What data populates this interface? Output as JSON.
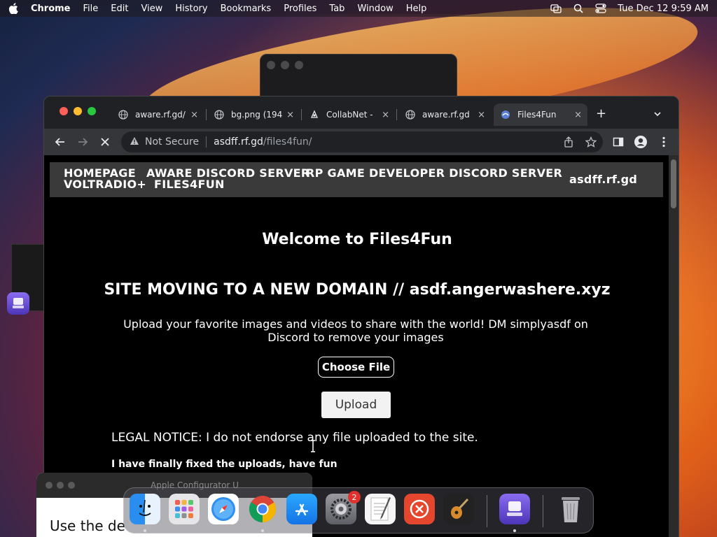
{
  "menubar": {
    "app": "Chrome",
    "items": [
      "File",
      "Edit",
      "View",
      "History",
      "Bookmarks",
      "Profiles",
      "Tab",
      "Window",
      "Help"
    ],
    "clock": "Tue Dec 12  9:59 AM"
  },
  "browser": {
    "tabs": [
      {
        "title": "aware.rf.gd/",
        "icon": "globe-icon"
      },
      {
        "title": "bg.png (194",
        "icon": "globe-icon"
      },
      {
        "title": "CollabNet -",
        "icon": "collabnet-icon"
      },
      {
        "title": "aware.rf.gd",
        "icon": "globe-icon"
      },
      {
        "title": "Files4Fun",
        "icon": "files4fun-icon",
        "active": true
      }
    ],
    "close_glyph": "×",
    "new_tab_glyph": "+",
    "security_label": "Not Secure",
    "url_host": "asdff.rf.gd",
    "url_path": "/files4fun/"
  },
  "site": {
    "nav": {
      "homepage": "HOMEPAGE",
      "aware": "AWARE DISCORD SERVER",
      "rp": "RP GAME DEVELOPER DISCORD SERVER",
      "brand": "asdff.rf.gd",
      "voltradio": "VOLTRADIO+",
      "files4fun": "FILES4FUN"
    },
    "welcome": "Welcome to Files4Fun",
    "moving": "SITE MOVING TO A NEW DOMAIN // asdf.angerwashere.xyz",
    "upload_text": "Upload your favorite images and videos to share with the world! DM simplyasdf on Discord to remove your images",
    "choose_file": "Choose File",
    "upload": "Upload",
    "legal": "LEGAL NOTICE: I do not endorse any file uploaded to the site.",
    "fixed": "I have finally fixed the uploads, have fun"
  },
  "configurator": {
    "title": "Apple Configurator U",
    "body": "Use the de"
  },
  "dock": {
    "apps": [
      "Finder",
      "Launchpad",
      "Safari",
      "Google Chrome",
      "App Store",
      "System Settings",
      "TextEdit",
      "Microsoft Remote Desktop",
      "GarageBand",
      "Apple Configurator",
      "Trash"
    ],
    "settings_badge": "2"
  }
}
